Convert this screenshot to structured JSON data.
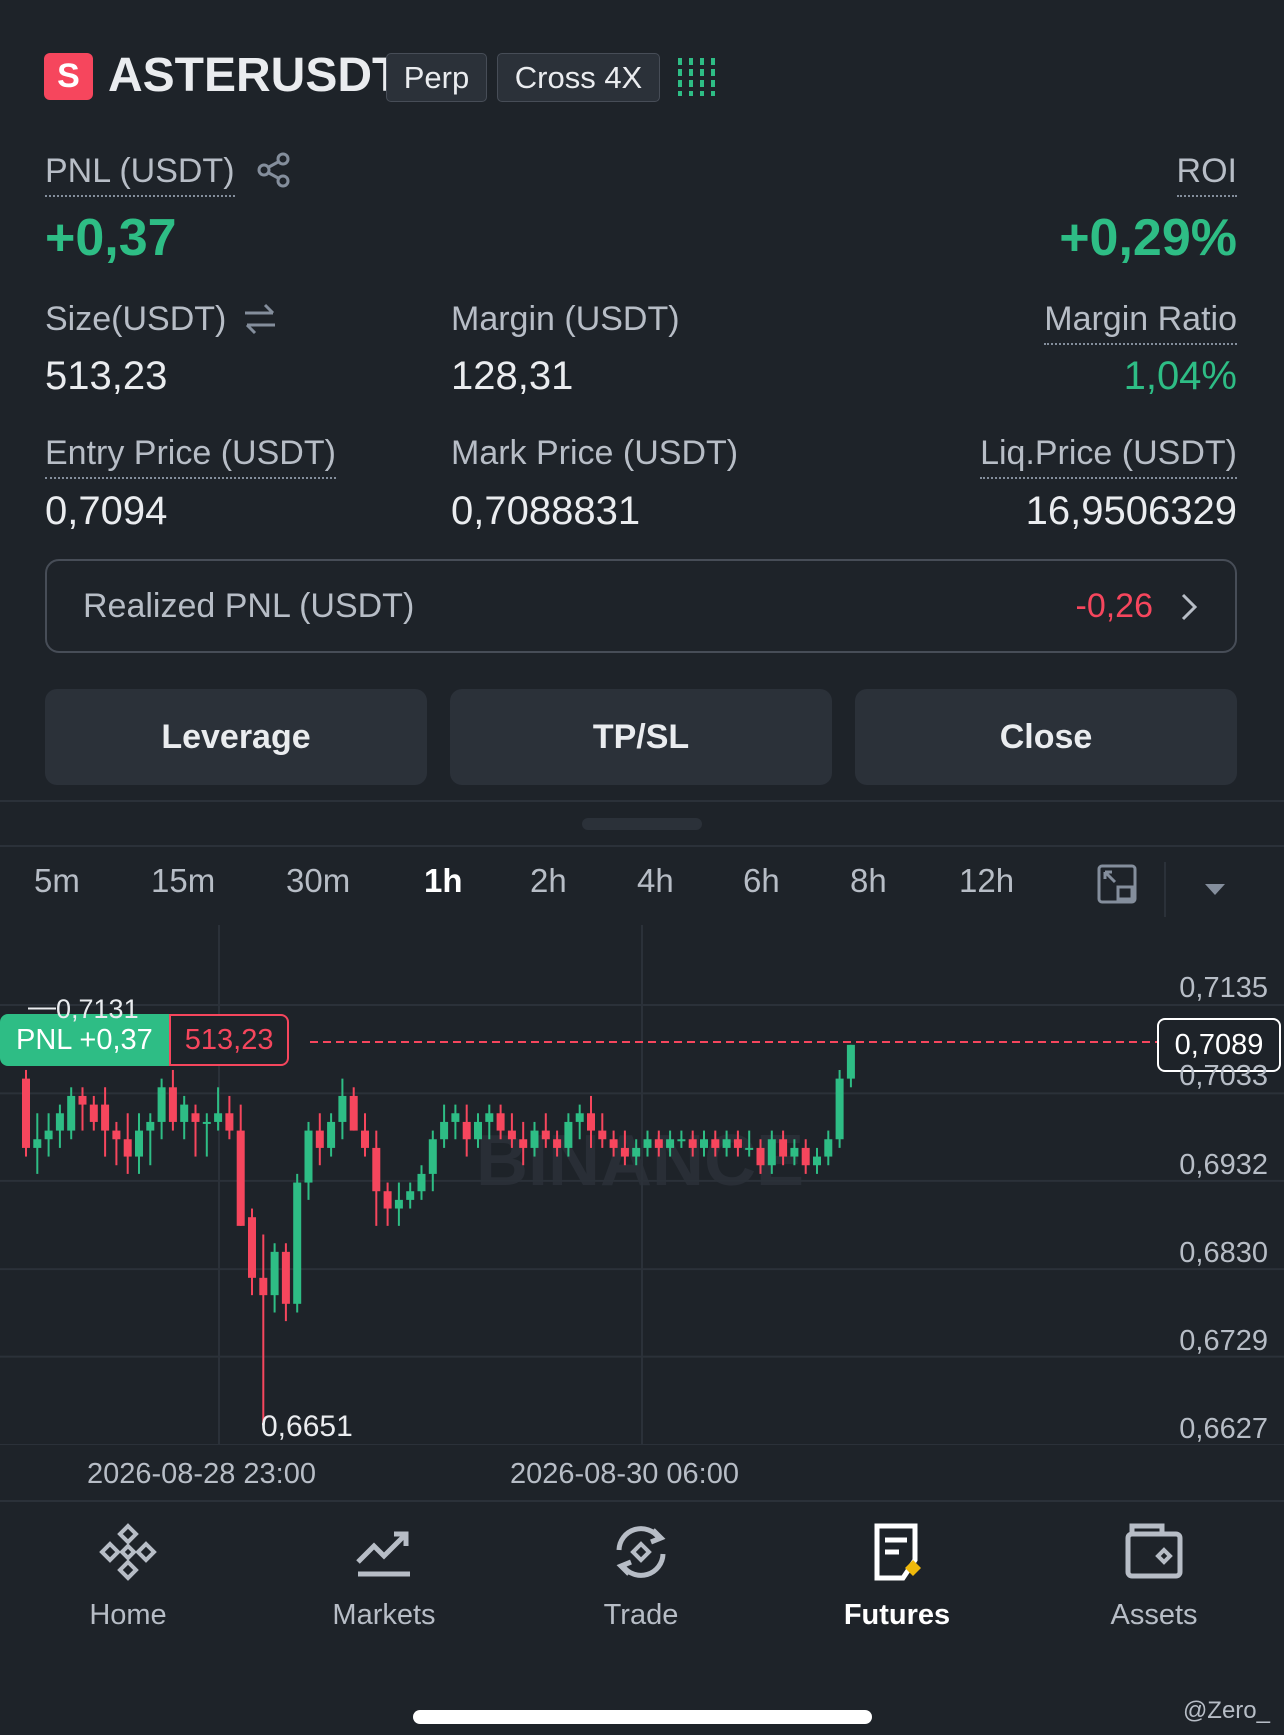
{
  "position": {
    "badge": "S",
    "symbol": "ASTERUSDT",
    "type_tag": "Perp",
    "margin_tag": "Cross 4X"
  },
  "pnl": {
    "label": "PNL (USDT)",
    "value": "+0,37"
  },
  "roi": {
    "label": "ROI",
    "value": "+0,29%"
  },
  "size": {
    "label": "Size(USDT)",
    "value": "513,23"
  },
  "margin": {
    "label": "Margin (USDT)",
    "value": "128,31"
  },
  "margin_ratio": {
    "label": "Margin Ratio",
    "value": "1,04%"
  },
  "entry_price": {
    "label": "Entry Price (USDT)",
    "value": "0,7094"
  },
  "mark_price": {
    "label": "Mark Price (USDT)",
    "value": "0,7088831"
  },
  "liq_price": {
    "label": "Liq.Price (USDT)",
    "value": "16,9506329"
  },
  "realized_pnl": {
    "label": "Realized PNL (USDT)",
    "value": "-0,26"
  },
  "actions": {
    "leverage": "Leverage",
    "tpsl": "TP/SL",
    "close": "Close"
  },
  "timeframes": [
    "5m",
    "15m",
    "30m",
    "1h",
    "2h",
    "4h",
    "6h",
    "8h",
    "12h"
  ],
  "active_timeframe": "1h",
  "chart": {
    "high_label": "0,7131",
    "low_label": "0,6651",
    "pnl_tag": "PNL +0,37",
    "size_tag": "513,23",
    "current_price": "0,7089",
    "watermark": "BINANCE",
    "x_labels": [
      "2026-08-28 23:00",
      "2026-08-30 06:00"
    ]
  },
  "chart_data": {
    "type": "candlestick",
    "y_ticks": [
      "0,7135",
      "0,7033",
      "0,6932",
      "0,6830",
      "0,6729",
      "0,6627"
    ],
    "y_tick_values": [
      0.7135,
      0.7033,
      0.6932,
      0.683,
      0.6729,
      0.6627
    ],
    "ylim": [
      0.6627,
      0.7135
    ],
    "current_price": 0.7089,
    "high": 0.7131,
    "low": 0.6651,
    "candles": [
      [
        0.705,
        0.706,
        0.696,
        0.697
      ],
      [
        0.697,
        0.701,
        0.694,
        0.698
      ],
      [
        0.698,
        0.701,
        0.696,
        0.699
      ],
      [
        0.699,
        0.702,
        0.697,
        0.701
      ],
      [
        0.699,
        0.704,
        0.698,
        0.703
      ],
      [
        0.703,
        0.704,
        0.699,
        0.702
      ],
      [
        0.702,
        0.703,
        0.699,
        0.7
      ],
      [
        0.702,
        0.704,
        0.696,
        0.699
      ],
      [
        0.699,
        0.7,
        0.695,
        0.698
      ],
      [
        0.698,
        0.701,
        0.694,
        0.696
      ],
      [
        0.696,
        0.701,
        0.694,
        0.699
      ],
      [
        0.699,
        0.701,
        0.695,
        0.7
      ],
      [
        0.7,
        0.705,
        0.698,
        0.704
      ],
      [
        0.704,
        0.706,
        0.699,
        0.7
      ],
      [
        0.7,
        0.703,
        0.698,
        0.702
      ],
      [
        0.701,
        0.702,
        0.696,
        0.7
      ],
      [
        0.7,
        0.701,
        0.696,
        0.7
      ],
      [
        0.7,
        0.704,
        0.699,
        0.701
      ],
      [
        0.701,
        0.703,
        0.698,
        0.699
      ],
      [
        0.699,
        0.702,
        0.688,
        0.688
      ],
      [
        0.689,
        0.69,
        0.68,
        0.682
      ],
      [
        0.682,
        0.687,
        0.665,
        0.68
      ],
      [
        0.68,
        0.686,
        0.678,
        0.685
      ],
      [
        0.685,
        0.686,
        0.677,
        0.679
      ],
      [
        0.679,
        0.694,
        0.678,
        0.693
      ],
      [
        0.693,
        0.7,
        0.691,
        0.699
      ],
      [
        0.699,
        0.701,
        0.695,
        0.697
      ],
      [
        0.697,
        0.701,
        0.696,
        0.7
      ],
      [
        0.7,
        0.705,
        0.698,
        0.703
      ],
      [
        0.703,
        0.704,
        0.699,
        0.699
      ],
      [
        0.699,
        0.701,
        0.696,
        0.697
      ],
      [
        0.697,
        0.699,
        0.688,
        0.692
      ],
      [
        0.692,
        0.693,
        0.688,
        0.69
      ],
      [
        0.69,
        0.693,
        0.688,
        0.691
      ],
      [
        0.691,
        0.693,
        0.69,
        0.692
      ],
      [
        0.692,
        0.695,
        0.691,
        0.694
      ],
      [
        0.694,
        0.699,
        0.692,
        0.698
      ],
      [
        0.698,
        0.702,
        0.697,
        0.7
      ],
      [
        0.7,
        0.702,
        0.698,
        0.701
      ],
      [
        0.7,
        0.702,
        0.696,
        0.698
      ],
      [
        0.698,
        0.701,
        0.697,
        0.7
      ],
      [
        0.7,
        0.702,
        0.698,
        0.701
      ],
      [
        0.701,
        0.702,
        0.698,
        0.699
      ],
      [
        0.699,
        0.701,
        0.697,
        0.698
      ],
      [
        0.698,
        0.7,
        0.695,
        0.697
      ],
      [
        0.697,
        0.7,
        0.696,
        0.699
      ],
      [
        0.699,
        0.701,
        0.697,
        0.698
      ],
      [
        0.698,
        0.699,
        0.696,
        0.697
      ],
      [
        0.697,
        0.701,
        0.696,
        0.7
      ],
      [
        0.7,
        0.702,
        0.698,
        0.701
      ],
      [
        0.701,
        0.703,
        0.697,
        0.699
      ],
      [
        0.699,
        0.701,
        0.697,
        0.698
      ],
      [
        0.698,
        0.699,
        0.696,
        0.697
      ],
      [
        0.697,
        0.699,
        0.695,
        0.696
      ],
      [
        0.696,
        0.698,
        0.695,
        0.697
      ],
      [
        0.697,
        0.699,
        0.696,
        0.698
      ],
      [
        0.698,
        0.699,
        0.696,
        0.697
      ],
      [
        0.697,
        0.699,
        0.696,
        0.698
      ],
      [
        0.698,
        0.699,
        0.697,
        0.698
      ],
      [
        0.698,
        0.699,
        0.696,
        0.697
      ],
      [
        0.697,
        0.699,
        0.696,
        0.698
      ],
      [
        0.698,
        0.699,
        0.696,
        0.697
      ],
      [
        0.697,
        0.699,
        0.696,
        0.698
      ],
      [
        0.698,
        0.699,
        0.696,
        0.697
      ],
      [
        0.697,
        0.699,
        0.696,
        0.697
      ],
      [
        0.697,
        0.698,
        0.694,
        0.695
      ],
      [
        0.695,
        0.699,
        0.694,
        0.698
      ],
      [
        0.698,
        0.699,
        0.695,
        0.696
      ],
      [
        0.696,
        0.698,
        0.695,
        0.697
      ],
      [
        0.697,
        0.698,
        0.694,
        0.695
      ],
      [
        0.695,
        0.697,
        0.694,
        0.696
      ],
      [
        0.696,
        0.699,
        0.695,
        0.698
      ],
      [
        0.698,
        0.706,
        0.697,
        0.705
      ],
      [
        0.705,
        0.7089,
        0.704,
        0.7089
      ]
    ]
  },
  "nav": [
    {
      "label": "Home",
      "icon": "home-icon"
    },
    {
      "label": "Markets",
      "icon": "markets-icon"
    },
    {
      "label": "Trade",
      "icon": "trade-icon"
    },
    {
      "label": "Futures",
      "icon": "futures-icon"
    },
    {
      "label": "Assets",
      "icon": "assets-icon"
    }
  ],
  "watermark_user": "@Zero_",
  "colors": {
    "up": "#2ebd85",
    "down": "#f6465d",
    "bg": "#1e2329",
    "panel": "#2b3139"
  }
}
